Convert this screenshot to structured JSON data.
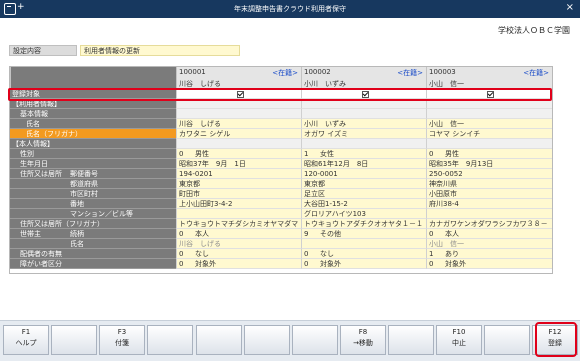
{
  "window": {
    "title": "年末調整申告書クラウド利用者保守",
    "close": "×"
  },
  "company": "学校法人ＯＢＣ学園",
  "setting": {
    "label": "設定内容",
    "value": "利用者情報の更新"
  },
  "columns": [
    {
      "code": "100001",
      "edit": "<在籍>",
      "name": "川谷　しげる"
    },
    {
      "code": "100002",
      "edit": "<在籍>",
      "name": "小川　いずみ"
    },
    {
      "code": "100003",
      "edit": "<在籍>",
      "name": "小山　信一"
    }
  ],
  "rows": [
    {
      "l1": "登録対象",
      "check": true
    },
    {
      "l1": "【利用者情報】"
    },
    {
      "l2": "基本情報"
    },
    {
      "l3": "氏名",
      "vals": [
        "川谷　しげる",
        "小川　いずみ",
        "小山　信一"
      ]
    },
    {
      "l3": "氏名（フリガナ）",
      "orange": true,
      "vals": [
        "カワタニ シゲル",
        "オガワ イズミ",
        "コヤマ シンイチ"
      ]
    },
    {
      "l1": "【本人情報】"
    },
    {
      "l2": "性別",
      "codes": [
        "0",
        "1",
        "0"
      ],
      "vals": [
        "男性",
        "女性",
        "男性"
      ]
    },
    {
      "l2": "生年月日",
      "vals": [
        "昭和37年　9月　1日",
        "昭和61年12月　8日",
        "昭和35年　9月13日"
      ]
    },
    {
      "l2": "住所又は居所",
      "l3": "郵便番号",
      "vals": [
        "194-0201",
        "120-0001",
        "250-0052"
      ]
    },
    {
      "l3": "都道府県",
      "vals": [
        "東京都",
        "東京都",
        "神奈川県"
      ]
    },
    {
      "l3": "市区町村",
      "vals": [
        "町田市",
        "足立区",
        "小田原市"
      ]
    },
    {
      "l3": "番地",
      "vals": [
        "上小山田町3-4-2",
        "大谷田1-15-2",
        "府川38-4"
      ]
    },
    {
      "l3": "マンション／ビル等",
      "vals": [
        "",
        "グロリアハイツ103",
        ""
      ]
    },
    {
      "l2": "住所又は居所（フリガナ）",
      "vals": [
        "トウキョウトマチダシカミオヤマダマ",
        "トウキョウトアダチクオオヤタ１－１",
        "カナガワケンオダワラシフカワ３８－"
      ]
    },
    {
      "l2": "世帯主",
      "l3": "続柄",
      "codes": [
        "0",
        "9",
        "0"
      ],
      "vals": [
        "本人",
        "その他",
        "本人"
      ]
    },
    {
      "l3": "氏名",
      "gray": true,
      "vals": [
        "川谷　しげる",
        "",
        "小山　信一"
      ]
    },
    {
      "l2": "配偶者の有無",
      "codes": [
        "0",
        "0",
        "1"
      ],
      "vals": [
        "なし",
        "なし",
        "あり"
      ]
    },
    {
      "l2": "障がい者区分",
      "codes": [
        "0",
        "0",
        "0"
      ],
      "vals": [
        "対象外",
        "対象外",
        "対象外"
      ]
    }
  ],
  "fkeys": [
    {
      "key": "F1",
      "label": "ヘルプ"
    },
    {
      "key": "",
      "label": ""
    },
    {
      "key": "F3",
      "label": "付箋"
    },
    {
      "key": "",
      "label": ""
    },
    {
      "key": "",
      "label": ""
    },
    {
      "key": "",
      "label": ""
    },
    {
      "key": "",
      "label": ""
    },
    {
      "key": "F8",
      "label": "→移動"
    },
    {
      "key": "",
      "label": ""
    },
    {
      "key": "F10",
      "label": "中止"
    },
    {
      "key": "",
      "label": ""
    },
    {
      "key": "F12",
      "label": "登録"
    }
  ],
  "colors": {
    "titlebar": "#17385f",
    "label": "#7b7b7b",
    "label_highlight": "#f39a1f",
    "cell": "#fff9d0",
    "alert": "#e0001a"
  }
}
